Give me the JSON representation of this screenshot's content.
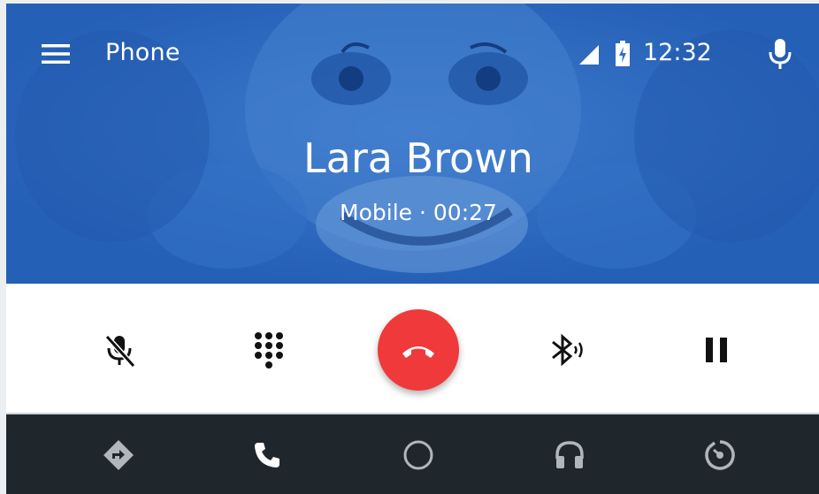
{
  "app": {
    "title": "Phone"
  },
  "status": {
    "time": "12:32",
    "signal_icon": "signal-icon",
    "battery_icon": "battery-charging-icon"
  },
  "call": {
    "caller_name": "Lara Brown",
    "line_type": "Mobile",
    "separator": " · ",
    "duration": "00:27"
  },
  "controls": [
    {
      "name": "mute",
      "icon": "mic-off-icon"
    },
    {
      "name": "dialpad",
      "icon": "dialpad-icon"
    },
    {
      "name": "end-call",
      "icon": "call-end-icon"
    },
    {
      "name": "bluetooth-audio",
      "icon": "bluetooth-audio-icon"
    },
    {
      "name": "hold",
      "icon": "pause-icon"
    }
  ],
  "navbar": [
    {
      "name": "navigation",
      "icon": "directions-icon"
    },
    {
      "name": "phone",
      "icon": "phone-icon"
    },
    {
      "name": "home",
      "icon": "home-circle-icon"
    },
    {
      "name": "media",
      "icon": "headphones-icon"
    },
    {
      "name": "overview",
      "icon": "dashboard-icon"
    }
  ],
  "colors": {
    "header_blue": "#2f6fc7",
    "end_call_red": "#f0393a",
    "navbar_bg": "#1f272d",
    "nav_icon": "#b0b6ba"
  }
}
